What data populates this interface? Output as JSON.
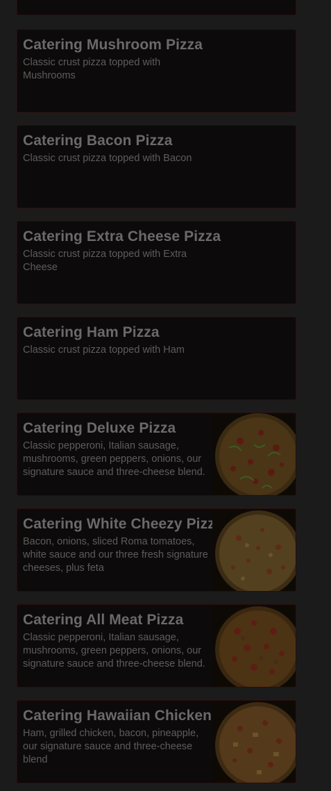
{
  "menu_items": [
    {
      "title": "Catering Mushroom Pizza",
      "description": "Classic crust pizza topped with Mushrooms",
      "image": null
    },
    {
      "title": "Catering Bacon Pizza",
      "description": "Classic crust pizza topped with Bacon",
      "image": null
    },
    {
      "title": "Catering Extra Cheese Pizza",
      "description": "Classic crust pizza topped with Extra Cheese",
      "image": null
    },
    {
      "title": "Catering Ham Pizza",
      "description": "Classic crust pizza topped with Ham",
      "image": null
    },
    {
      "title": "Catering Deluxe Pizza",
      "description": "Classic pepperoni, Italian sausage, mushrooms, green peppers, onions, our signature sauce and three-cheese blend.",
      "image": "deluxe-pizza-photo"
    },
    {
      "title": "Catering White Cheezy Pizza",
      "description": "Bacon, onions, sliced Roma tomatoes, white sauce and our three fresh signature cheeses, plus feta",
      "image": "white-cheezy-pizza-photo"
    },
    {
      "title": "Catering All Meat Pizza",
      "description": "Classic pepperoni, Italian sausage, mushrooms, green peppers, onions, our signature sauce and three-cheese blend.",
      "image": "all-meat-pizza-photo"
    },
    {
      "title": "Catering Hawaiian Chicken",
      "description": "Ham, grilled chicken, bacon, pineapple, our signature sauce and three-cheese blend",
      "image": "hawaiian-chicken-pizza-photo"
    }
  ],
  "colors": {
    "background": "#1c1b1b",
    "card": "#0c0a0a",
    "card_border": "#2a0d0d",
    "title": "#6b6a6a",
    "description": "#5e5c5c"
  }
}
